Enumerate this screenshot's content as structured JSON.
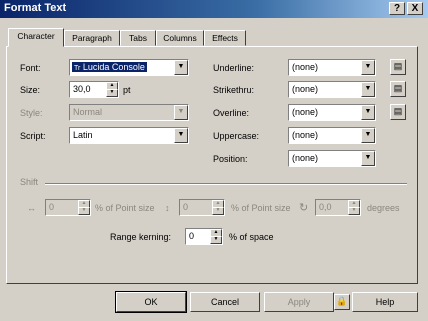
{
  "window": {
    "title": "Format Text",
    "help_btn": "?",
    "close_btn": "X"
  },
  "tabs": [
    "Character",
    "Paragraph",
    "Tabs",
    "Columns",
    "Effects"
  ],
  "left": {
    "font_label": "Font:",
    "font_value": "Lucida Console",
    "font_icon_glyph": "Tr",
    "size_label": "Size:",
    "size_value": "30,0",
    "size_unit": "pt",
    "style_label": "Style:",
    "style_value": "Normal",
    "script_label": "Script:",
    "script_value": "Latin"
  },
  "right": {
    "underline_label": "Underline:",
    "underline_value": "(none)",
    "strikethru_label": "Strikethru:",
    "strikethru_value": "(none)",
    "overline_label": "Overline:",
    "overline_value": "(none)",
    "uppercase_label": "Uppercase:",
    "uppercase_value": "(none)",
    "position_label": "Position:",
    "position_value": "(none)"
  },
  "shift": {
    "label": "Shift",
    "h_value": "0",
    "h_unit": "% of Point size",
    "v_value": "0",
    "v_unit": "% of Point size",
    "angle_value": "0,0",
    "angle_unit": "degrees"
  },
  "kerning": {
    "label": "Range kerning:",
    "value": "0",
    "unit": "% of space"
  },
  "buttons": {
    "ok": "OK",
    "cancel": "Cancel",
    "apply": "Apply",
    "help": "Help"
  }
}
